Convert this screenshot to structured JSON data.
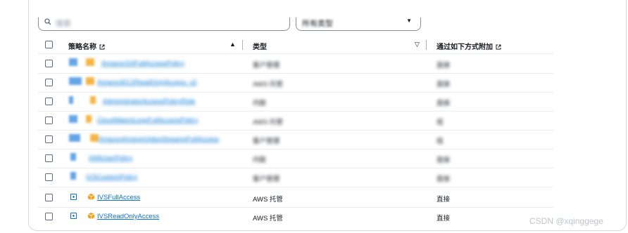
{
  "toolbar": {
    "search_placeholder": "搜索",
    "type_filter": "所有类型"
  },
  "table": {
    "columns": {
      "name": "策略名称",
      "type": "类型",
      "attach": "通过如下方式附加"
    },
    "blurred_rows": [
      {
        "name": "AmazonS3FullAccessPolicy",
        "type": "客户管理",
        "attach": "直接"
      },
      {
        "name": "AmazonEC2ReadOnlyAccess_v2",
        "type": "AWS 托管",
        "attach": "直接"
      },
      {
        "name": "AdministratorAccessPolicyRole",
        "type": "内联",
        "attach": "直接"
      },
      {
        "name": "CloudWatchLogsFullAccessPolicy",
        "type": "AWS 托管",
        "attach": "组"
      },
      {
        "name": "AmazonKinesisVideoStreamsFullAccess",
        "type": "客户管理",
        "attach": "组"
      },
      {
        "name": "IAMUserPolicy",
        "type": "内联",
        "attach": "直接"
      },
      {
        "name": "IVSCustomPolicy",
        "type": "客户管理",
        "attach": "直接"
      }
    ],
    "rows": [
      {
        "name": "IVSFullAccess",
        "type": "AWS 托管",
        "attach": "直接"
      },
      {
        "name": "IVSReadOnlyAccess",
        "type": "AWS 托管",
        "attach": "直接"
      }
    ]
  },
  "watermark": "CSDN @xqinggege",
  "colors": {
    "link": "#0972d3",
    "accent_box": "#f3a21a",
    "border": "#d5dbdb"
  }
}
